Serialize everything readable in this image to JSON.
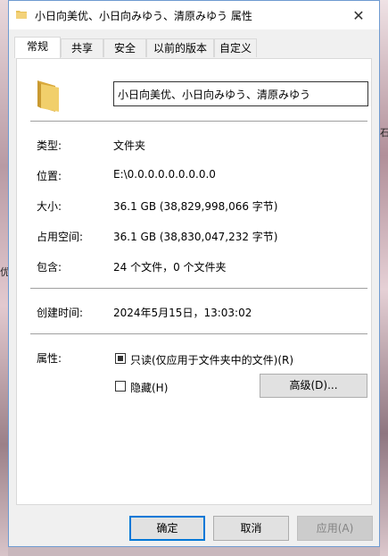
{
  "window": {
    "title": "小日向美优、小日向みゆう、清原みゆう 属性",
    "close_glyph": "✕",
    "title_icon": "folder-icon"
  },
  "tabs": [
    {
      "label": "常规",
      "active": true
    },
    {
      "label": "共享",
      "active": false
    },
    {
      "label": "安全",
      "active": false
    },
    {
      "label": "以前的版本",
      "active": false
    },
    {
      "label": "自定义",
      "active": false
    }
  ],
  "general": {
    "folder_icon": "folder-icon",
    "name_value": "小日向美优、小日向みゆう、清原みゆう",
    "type_label": "类型:",
    "type_value": "文件夹",
    "location_label": "位置:",
    "location_value": "E:\\0.0.0.0.0.0.0.0.0",
    "size_label": "大小:",
    "size_value": "36.1 GB (38,829,998,066 字节)",
    "size_on_disk_label": "占用空间:",
    "size_on_disk_value": "36.1 GB (38,830,047,232 字节)",
    "contains_label": "包含:",
    "contains_value": "24 个文件，0 个文件夹",
    "created_label": "创建时间:",
    "created_value": "2024年5月15日，13:03:02",
    "attributes_label": "属性:",
    "readonly_label": "只读(仅应用于文件夹中的文件)(R)",
    "readonly_state": "indeterminate",
    "hidden_label": "隐藏(H)",
    "hidden_checked": false,
    "advanced_label": "高级(D)..."
  },
  "buttons": {
    "ok": "确定",
    "cancel": "取消",
    "apply": "应用(A)"
  },
  "background": {
    "left_text": "优",
    "right_text": "石"
  },
  "colors": {
    "accent": "#0078d7",
    "folder": "#e8c25a",
    "panel": "#ffffff",
    "dialog": "#f0f0f0"
  }
}
